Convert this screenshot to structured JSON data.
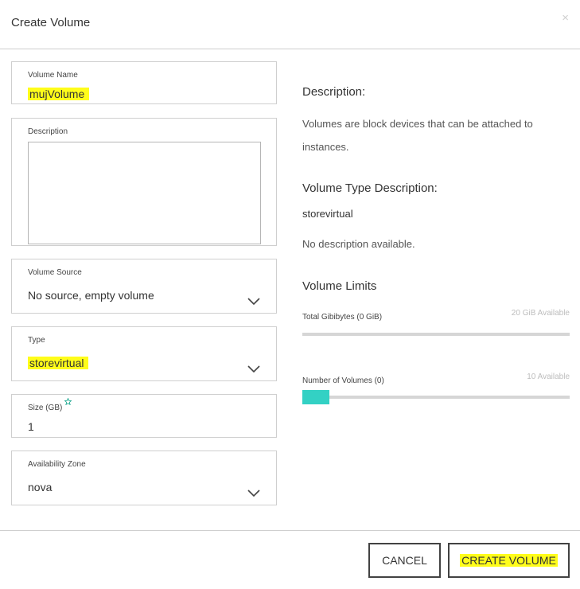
{
  "dialog": {
    "title": "Create Volume",
    "close_glyph": "×"
  },
  "form": {
    "volume_name": {
      "label": "Volume Name",
      "value": "mujVolume"
    },
    "description": {
      "label": "Description",
      "value": ""
    },
    "volume_source": {
      "label": "Volume Source",
      "value": "No source, empty volume"
    },
    "type": {
      "label": "Type",
      "value": "storevirtual"
    },
    "size": {
      "label": "Size (GB)",
      "value": "1"
    },
    "availability_zone": {
      "label": "Availability Zone",
      "value": "nova"
    }
  },
  "info": {
    "description_heading": "Description:",
    "description_text": "Volumes are block devices that can be attached to instances.",
    "type_heading": "Volume Type Description:",
    "type_name": "storevirtual",
    "type_text": "No description available.",
    "limits_heading": "Volume Limits",
    "gibibytes_label": "Total Gibibytes (0 GiB)",
    "gibibytes_available": "20 GiB Available",
    "gibibytes_used_fraction": 0,
    "volumes_label": "Number of Volumes (0)",
    "volumes_available": "10 Available",
    "volumes_used_fraction": 0.1
  },
  "footer": {
    "cancel_label": "CANCEL",
    "create_label": "CREATE VOLUME"
  },
  "colors": {
    "highlight": "#fffd1a",
    "progress": "#33d1c4",
    "required": "#1aa78f"
  },
  "icons": [
    "close-icon",
    "chevron-down-icon",
    "required-star-icon",
    "resize-grip-icon"
  ]
}
